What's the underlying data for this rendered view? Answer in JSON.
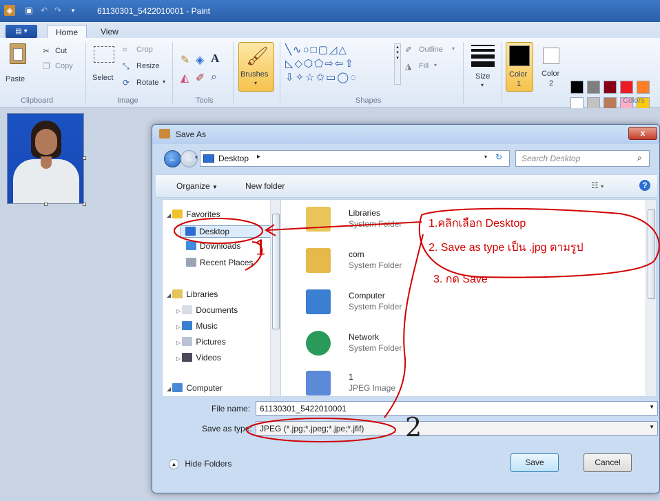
{
  "window": {
    "title": "61130301_5422010001 - Paint"
  },
  "tabs": [
    "Home",
    "View"
  ],
  "ribbon": {
    "clipboard": {
      "paste": "Paste",
      "cut": "Cut",
      "copy": "Copy",
      "label": "Clipboard"
    },
    "image": {
      "select": "Select",
      "crop": "Crop",
      "resize": "Resize",
      "rotate": "Rotate",
      "label": "Image"
    },
    "tools": {
      "label": "Tools",
      "text_tool": "A"
    },
    "brushes": "Brushes",
    "shapes": {
      "outline": "Outline",
      "fill": "Fill",
      "label": "Shapes"
    },
    "size": "Size",
    "color1": {
      "name": "Color",
      "num": "1"
    },
    "color2": {
      "name": "Color",
      "num": "2"
    },
    "colors_label": "Colors",
    "palette_row1": [
      "#000000",
      "#7f7f7f",
      "#880015",
      "#ed1c24",
      "#ff7f27"
    ],
    "palette_row2": [
      "#ffffff",
      "#c3c3c3",
      "#b97a57",
      "#ffaec9",
      "#ffc90e"
    ]
  },
  "dialog": {
    "title": "Save As",
    "close": "x",
    "address": "Desktop",
    "search_placeholder": "Search Desktop",
    "organize": "Organize",
    "new_folder": "New folder",
    "nav": [
      {
        "label": "Favorites"
      },
      {
        "label": "Desktop"
      },
      {
        "label": "Downloads"
      },
      {
        "label": "Recent Places"
      },
      {
        "label": "Libraries"
      },
      {
        "label": "Documents"
      },
      {
        "label": "Music"
      },
      {
        "label": "Pictures"
      },
      {
        "label": "Videos"
      },
      {
        "label": "Computer"
      }
    ],
    "files": [
      {
        "name": "Libraries",
        "type": "System Folder"
      },
      {
        "name": "com",
        "type": "System Folder"
      },
      {
        "name": "Computer",
        "type": "System Folder"
      },
      {
        "name": "Network",
        "type": "System Folder"
      },
      {
        "name": "1",
        "type": "JPEG Image"
      }
    ],
    "file_name_label": "File name:",
    "file_name_value": "61130301_5422010001",
    "save_type_label": "Save as type:",
    "save_type_value": "JPEG (*.jpg;*.jpeg;*.jpe;*.jfif)",
    "hide_folders": "Hide Folders",
    "save": "Save",
    "cancel": "Cancel"
  },
  "annotations": {
    "step1": "1.คลิกเลือก Desktop",
    "step2": "2. Save as type เป็น .jpg ตามรูป",
    "step3": "3. กด Save",
    "mark1": "1",
    "mark2": "2"
  }
}
